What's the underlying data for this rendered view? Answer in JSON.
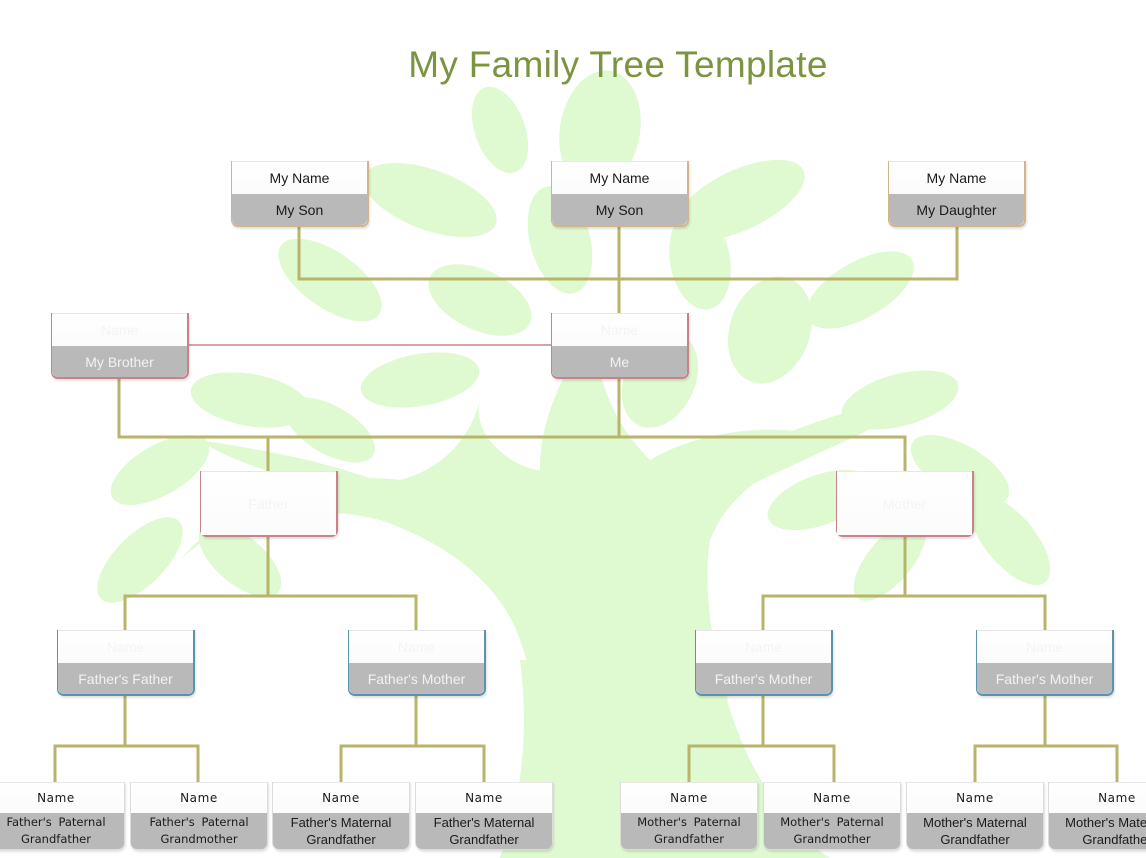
{
  "title": "My Family Tree Template",
  "colors": {
    "title": "#7b9440",
    "connector": "#b8b46a",
    "sibling_connector": "#c9828a",
    "tree_fill": "#dff9d0",
    "node_bottom": "#b9b9b9",
    "border_children": "#d4b48a",
    "border_me_parents": "#c9828a",
    "border_grandparents": "#5a93ad"
  },
  "children": [
    {
      "name": "My Name",
      "relation": "My Son"
    },
    {
      "name": "My Name",
      "relation": "My Son"
    },
    {
      "name": "My Name",
      "relation": "My Daughter"
    }
  ],
  "siblings": [
    {
      "name": "Name",
      "relation": "My Brother"
    }
  ],
  "me": {
    "name": "Name",
    "relation": "Me"
  },
  "parents": [
    {
      "name": "Father"
    },
    {
      "name": "Mother"
    }
  ],
  "grandparents": [
    {
      "name": "Name",
      "relation": "Father's Father"
    },
    {
      "name": "Name",
      "relation": "Father's Mother"
    },
    {
      "name": "Name",
      "relation": "Father's Mother"
    },
    {
      "name": "Name",
      "relation": "Father's Mother"
    }
  ],
  "great_grandparents": [
    {
      "name": "Name",
      "relation_line1": "Father's  Paternal",
      "relation_line2": "Grandfather"
    },
    {
      "name": "Name",
      "relation_line1": "Father's  Paternal",
      "relation_line2": "Grandmother"
    },
    {
      "name": "Name",
      "relation_line1": "Father's Maternal",
      "relation_line2": "Grandfather"
    },
    {
      "name": "Name",
      "relation_line1": "Father's Maternal",
      "relation_line2": "Grandfather"
    },
    {
      "name": "Name",
      "relation_line1": "Mother's  Paternal",
      "relation_line2": "Grandfather"
    },
    {
      "name": "Name",
      "relation_line1": "Mother's  Paternal",
      "relation_line2": "Grandmother"
    },
    {
      "name": "Name",
      "relation_line1": "Mother's Maternal",
      "relation_line2": "Grandfather"
    },
    {
      "name": "Name",
      "relation_line1": "Mother's Maternal",
      "relation_line2": "Grandfather"
    }
  ]
}
